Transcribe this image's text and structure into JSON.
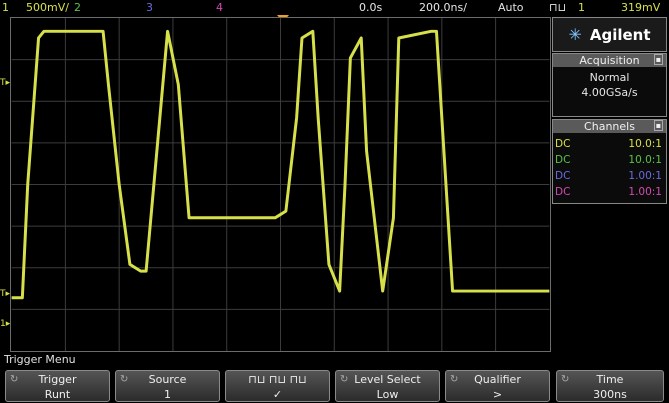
{
  "status_bar": {
    "ch1_number": "1",
    "ch1_scale": "500mV/",
    "ch2_number": "2",
    "ch3_number": "3",
    "ch4_number": "4",
    "time_position": "0.0s",
    "time_scale": "200.0ns/",
    "trigger_mode": "Auto",
    "trigger_type_symbol": "⊓⊔",
    "trigger_source": "1",
    "trigger_level": "319mV"
  },
  "logo": {
    "text": "Agilent"
  },
  "acquisition": {
    "header": "Acquisition",
    "mode": "Normal",
    "sample_rate": "4.00GSa/s"
  },
  "channels": {
    "header": "Channels",
    "rows": [
      {
        "coupling": "DC",
        "probe": "10.0:1",
        "color": "#d7e04a"
      },
      {
        "coupling": "DC",
        "probe": "10.0:1",
        "color": "#59c24a"
      },
      {
        "coupling": "DC",
        "probe": "1.00:1",
        "color": "#6a6ae0"
      },
      {
        "coupling": "DC",
        "probe": "1.00:1",
        "color": "#d24ab0"
      }
    ]
  },
  "trigger_menu": {
    "title": "Trigger Menu",
    "softkeys": [
      {
        "label": "Trigger",
        "value": "Runt"
      },
      {
        "label": "Source",
        "value": "1"
      },
      {
        "label": "⊓⊔ ⊓⊔ ⊓⊔",
        "value": "✓"
      },
      {
        "label": "Level Select",
        "value": "Low"
      },
      {
        "label": "Qualifier",
        "value": ">"
      },
      {
        "label": "Time",
        "value": "300ns"
      }
    ]
  },
  "markers": {
    "ch1_ground": "1",
    "trigger_high": "T",
    "trigger_low": "T"
  },
  "colors": {
    "ch1": "#d7e04a",
    "ch2": "#59c24a",
    "ch3": "#6a6ae0",
    "ch4": "#d24ab0",
    "grid": "#3c3c3c",
    "trigger_marker": "#f0a020"
  },
  "chart_data": {
    "type": "line",
    "series": [
      {
        "name": "1",
        "x": [
          0,
          0.02,
          0.03,
          0.05,
          0.06,
          0.07,
          0.17,
          0.18,
          0.2,
          0.22,
          0.24,
          0.25,
          0.27,
          0.29,
          0.31,
          0.33,
          0.49,
          0.51,
          0.53,
          0.54,
          0.56,
          0.57,
          0.59,
          0.61,
          0.62,
          0.63,
          0.65,
          0.66,
          0.69,
          0.71,
          0.72,
          0.78,
          0.79,
          0.8,
          0.82,
          1.0
        ],
        "y": [
          -1.7,
          -1.7,
          0.0,
          2.2,
          2.3,
          2.3,
          2.3,
          1.5,
          0.0,
          -1.2,
          -1.3,
          -1.3,
          0.5,
          2.3,
          1.5,
          -0.5,
          -0.5,
          -0.4,
          1.0,
          2.2,
          2.3,
          1.0,
          -1.2,
          -1.6,
          0.0,
          1.9,
          2.2,
          0.5,
          -1.6,
          -0.5,
          2.2,
          2.3,
          2.3,
          1.0,
          -1.6,
          -1.6
        ]
      }
    ],
    "xlim": [
      0,
      1
    ],
    "ylim": [
      -2.5,
      2.5
    ]
  }
}
